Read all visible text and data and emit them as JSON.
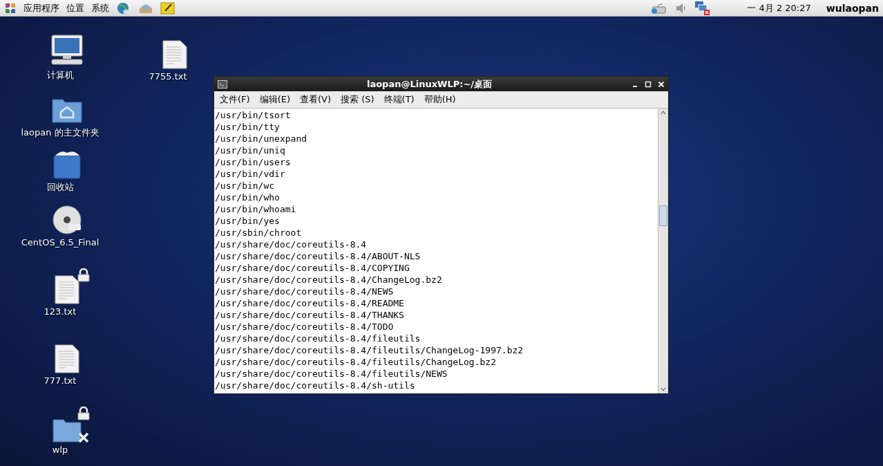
{
  "top_panel": {
    "menus": [
      "应用程序",
      "位置",
      "系统"
    ],
    "clock": "一 4月  2 20:27",
    "user": "wulaopan"
  },
  "desktop_icons": [
    {
      "kind": "computer",
      "label": "计算机",
      "locked": false,
      "no_access": false
    },
    {
      "kind": "home",
      "label": "laopan 的主文件夹",
      "locked": false,
      "no_access": false
    },
    {
      "kind": "trash",
      "label": "回收站",
      "locked": false,
      "no_access": false
    },
    {
      "kind": "dvd",
      "label": "CentOS_6.5_Final",
      "locked": false,
      "no_access": false
    },
    {
      "kind": "file",
      "label": "123.txt",
      "locked": true,
      "no_access": false
    },
    {
      "kind": "file",
      "label": "777.txt",
      "locked": false,
      "no_access": false
    },
    {
      "kind": "folder",
      "label": "wlp",
      "locked": true,
      "no_access": true
    },
    {
      "kind": "file",
      "label": "7755.txt",
      "locked": false,
      "no_access": false
    }
  ],
  "terminal": {
    "title": "laopan@LinuxWLP:~/桌面",
    "menu": [
      "文件(F)",
      "编辑(E)",
      "查看(V)",
      "搜索 (S)",
      "终端(T)",
      "帮助(H)"
    ],
    "lines": [
      "/usr/bin/tsort",
      "/usr/bin/tty",
      "/usr/bin/unexpand",
      "/usr/bin/uniq",
      "/usr/bin/users",
      "/usr/bin/vdir",
      "/usr/bin/wc",
      "/usr/bin/who",
      "/usr/bin/whoami",
      "/usr/bin/yes",
      "/usr/sbin/chroot",
      "/usr/share/doc/coreutils-8.4",
      "/usr/share/doc/coreutils-8.4/ABOUT-NLS",
      "/usr/share/doc/coreutils-8.4/COPYING",
      "/usr/share/doc/coreutils-8.4/ChangeLog.bz2",
      "/usr/share/doc/coreutils-8.4/NEWS",
      "/usr/share/doc/coreutils-8.4/README",
      "/usr/share/doc/coreutils-8.4/THANKS",
      "/usr/share/doc/coreutils-8.4/TODO",
      "/usr/share/doc/coreutils-8.4/fileutils",
      "/usr/share/doc/coreutils-8.4/fileutils/ChangeLog-1997.bz2",
      "/usr/share/doc/coreutils-8.4/fileutils/ChangeLog.bz2",
      "/usr/share/doc/coreutils-8.4/fileutils/NEWS",
      "/usr/share/doc/coreutils-8.4/sh-utils"
    ]
  }
}
